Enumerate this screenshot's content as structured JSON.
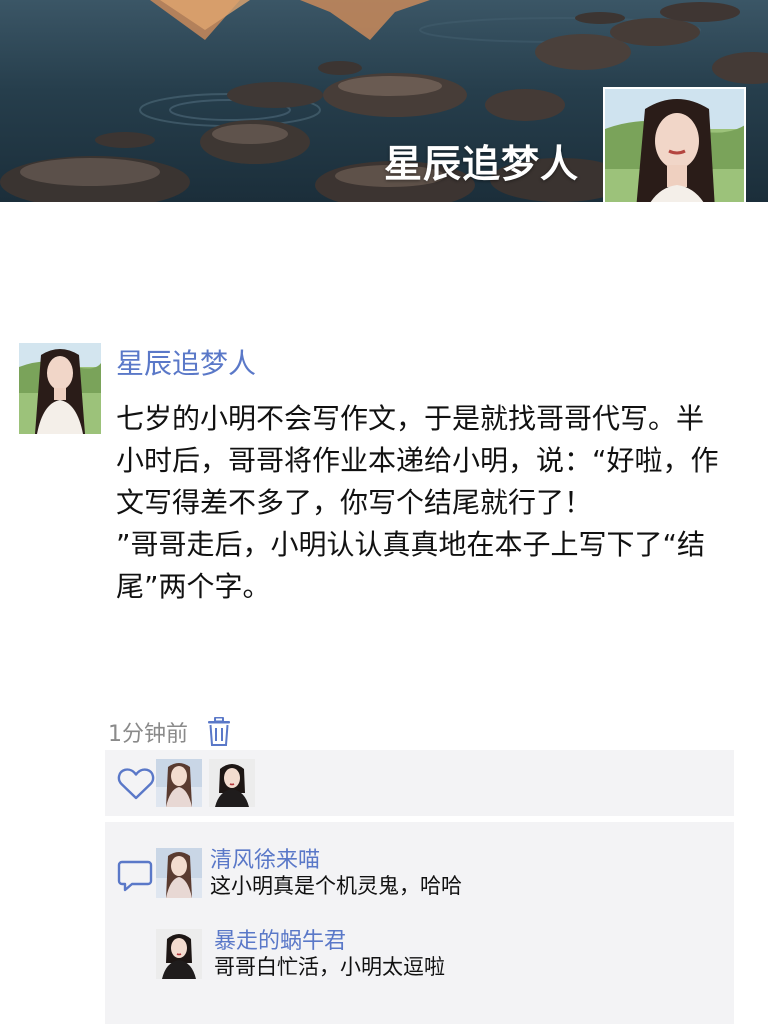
{
  "cover": {
    "title": "星辰追梦人"
  },
  "post": {
    "author": "星辰追梦人",
    "content": "七岁的小明不会写作文，于是就找哥哥代写。半小时后，哥哥将作业本递给小明，说：“好啦，作文写得差不多了，你写个结尾就行了！\n”哥哥走后，小明认认真真地在本子上写下了“结尾”两个字。",
    "time": "1分钟前",
    "delete_icon": "trash-icon"
  },
  "likes": {
    "icon": "heart-icon",
    "users": [
      "liker-avatar-1",
      "liker-avatar-2"
    ]
  },
  "comments": {
    "icon": "comment-icon",
    "items": [
      {
        "name": "清风徐来喵",
        "text": "这小明真是个机灵鬼，哈哈"
      },
      {
        "name": "暴走的蜗牛君",
        "text": "哥哥白忙活，小明太逗啦"
      }
    ]
  },
  "colors": {
    "name_link": "#5a78c8",
    "panel_bg": "#f3f3f5",
    "time_gray": "#8a8a8a"
  }
}
